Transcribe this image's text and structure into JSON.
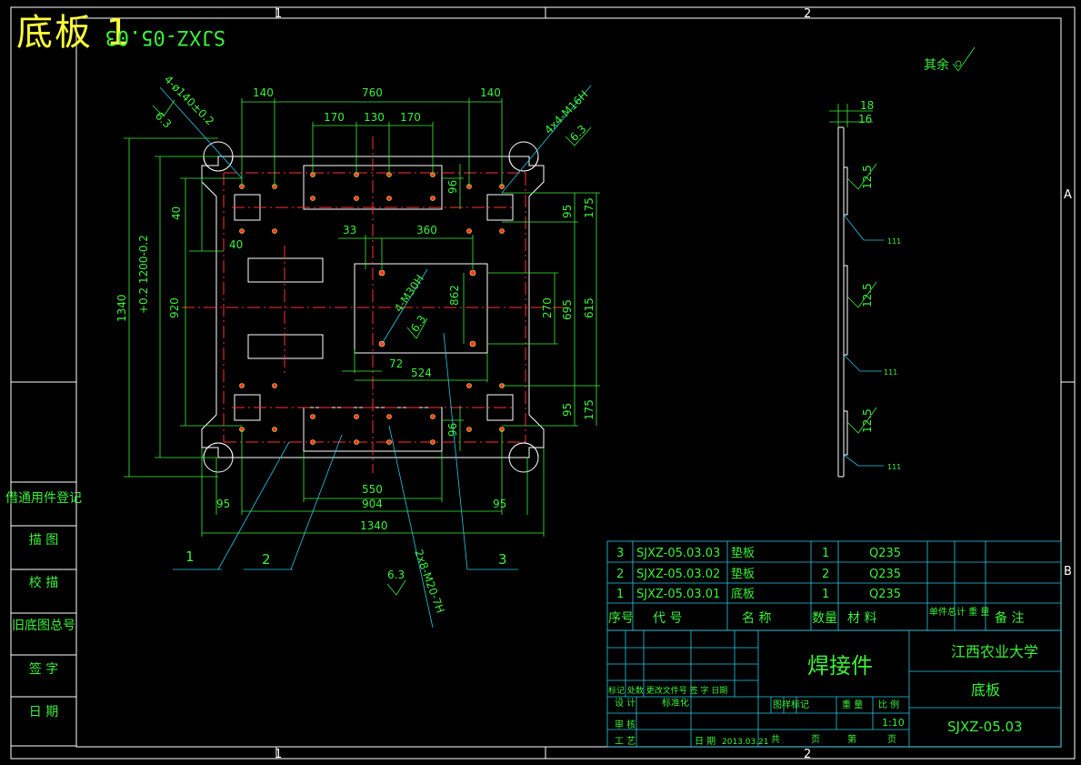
{
  "drawing": {
    "title": "底板 1",
    "title_box_code": "SJXZ-05.03",
    "colors": {
      "frame": "#ffffff",
      "dim": "#3cf03c",
      "outline": "#ffffff",
      "center": "#ff3030",
      "leader": "#28c8e8",
      "title": "#ffff3a",
      "text": "#3cf03c"
    },
    "zone_labels": {
      "top_left": "1",
      "top_right": "2",
      "right_a": "A",
      "right_b": "B",
      "bottom_left": "1",
      "bottom_right": "2"
    },
    "remainder_note": "其余",
    "front_view": {
      "dims_top": {
        "left": "140",
        "middle": "760",
        "right": "140",
        "sub1": "170",
        "sub2": "130",
        "sub3": "170"
      },
      "dims_left": {
        "overall": "1340",
        "tol": "+0.2\n1200-0.2",
        "inner": "920",
        "top": "40",
        "small": "40"
      },
      "dims_inner": {
        "d33": "33",
        "d360": "360",
        "d96a": "96",
        "d96b": "96",
        "d862": "862",
        "d72": "72",
        "d524": "524"
      },
      "dims_right": {
        "r95a": "95",
        "r175a": "175",
        "r270": "270",
        "r695": "695",
        "r615": "615",
        "r95b": "95",
        "r175b": "175"
      },
      "dims_bottom": {
        "b550": "550",
        "b904": "904",
        "b95a": "95",
        "b95b": "95",
        "b1340": "1340"
      },
      "callouts": {
        "hole_a": "4-ø140±0.2",
        "hole_b": "4x4-M16H",
        "hole_c": "4-M30H",
        "hole_d": "2x8-M20-7H",
        "rough_a": "6.3",
        "rough_b": "6.3",
        "rough_c": "6.3",
        "rough_d": "6.3"
      },
      "balloons": [
        "1",
        "2",
        "3"
      ]
    },
    "side_view": {
      "t18": "18",
      "t16": "16",
      "w1": "12.5",
      "w2": "12.5",
      "w3": "12.5",
      "w_sym": "111"
    },
    "left_strip": [
      "借通用件登记",
      "描  图",
      "校  描",
      "旧底图总号",
      "签  字",
      "日  期"
    ]
  },
  "bom": {
    "rows": [
      {
        "no": "3",
        "code": "SJXZ-05.03.03",
        "name": "垫板",
        "qty": "1",
        "material": "Q235"
      },
      {
        "no": "2",
        "code": "SJXZ-05.03.02",
        "name": "垫板",
        "qty": "2",
        "material": "Q235"
      },
      {
        "no": "1",
        "code": "SJXZ-05.03.01",
        "name": "底板",
        "qty": "1",
        "material": "Q235"
      }
    ],
    "header": {
      "no": "序号",
      "code": "代  号",
      "name": "名  称",
      "qty": "数量",
      "material": "材  料",
      "weight": "单件总计\n重  量",
      "remark": "备  注"
    }
  },
  "title_block": {
    "part_type": "焊接件",
    "school": "江西农业大学",
    "part_name": "底板",
    "drawing_no": "SJXZ-05.03",
    "scale": "1:10",
    "labels": {
      "revision": "标记 处数 更改文件号 签 字 日期",
      "design": "设 计",
      "std": "标准化",
      "check": "审 核",
      "process": "工 艺",
      "date": "日 期",
      "date_val": "2013.03.21",
      "stage": "图样标记",
      "weight": "重 量",
      "ratio": "比 例",
      "total": "共",
      "page": "页",
      "sheet": "第",
      "page2": "页"
    }
  }
}
